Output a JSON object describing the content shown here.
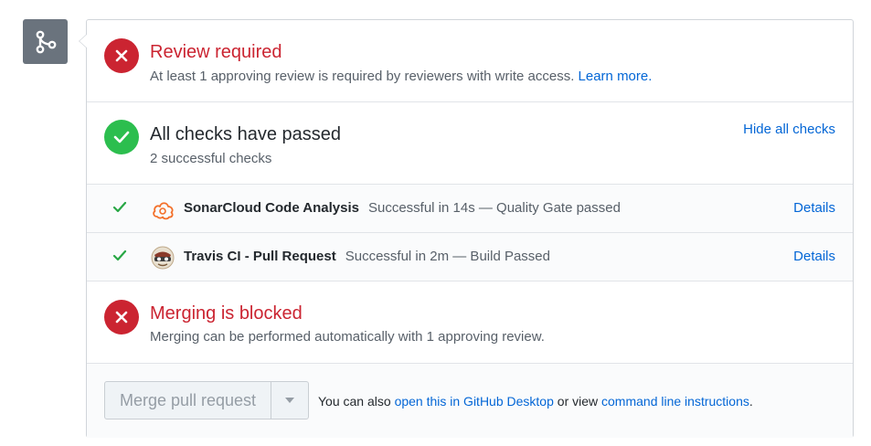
{
  "review": {
    "title": "Review required",
    "description": "At least 1 approving review is required by reviewers with write access.",
    "learn_more": "Learn more."
  },
  "checks": {
    "title": "All checks have passed",
    "subtitle": "2 successful checks",
    "hide_label": "Hide all checks",
    "items": [
      {
        "name": "SonarCloud Code Analysis",
        "description": "Successful in 14s — Quality Gate passed",
        "details": "Details",
        "logo": "sonarcloud-icon"
      },
      {
        "name": "Travis CI - Pull Request",
        "description": "Successful in 2m — Build Passed",
        "details": "Details",
        "logo": "travis-ci-icon"
      }
    ]
  },
  "blocked": {
    "title": "Merging is blocked",
    "description": "Merging can be performed automatically with 1 approving review."
  },
  "footer": {
    "merge_label": "Merge pull request",
    "text_prefix": "You can also ",
    "desktop_link": "open this in GitHub Desktop",
    "text_middle": " or view ",
    "cli_link": "command line instructions",
    "text_suffix": "."
  },
  "colors": {
    "fail": "#cb2431",
    "success": "#2cbe4e",
    "link": "#0366d6",
    "badge": "#6a737d"
  },
  "icons": {
    "badge": "git-merge-icon",
    "fail": "x-icon",
    "success": "check-icon",
    "dropdown": "triangle-down-icon"
  }
}
